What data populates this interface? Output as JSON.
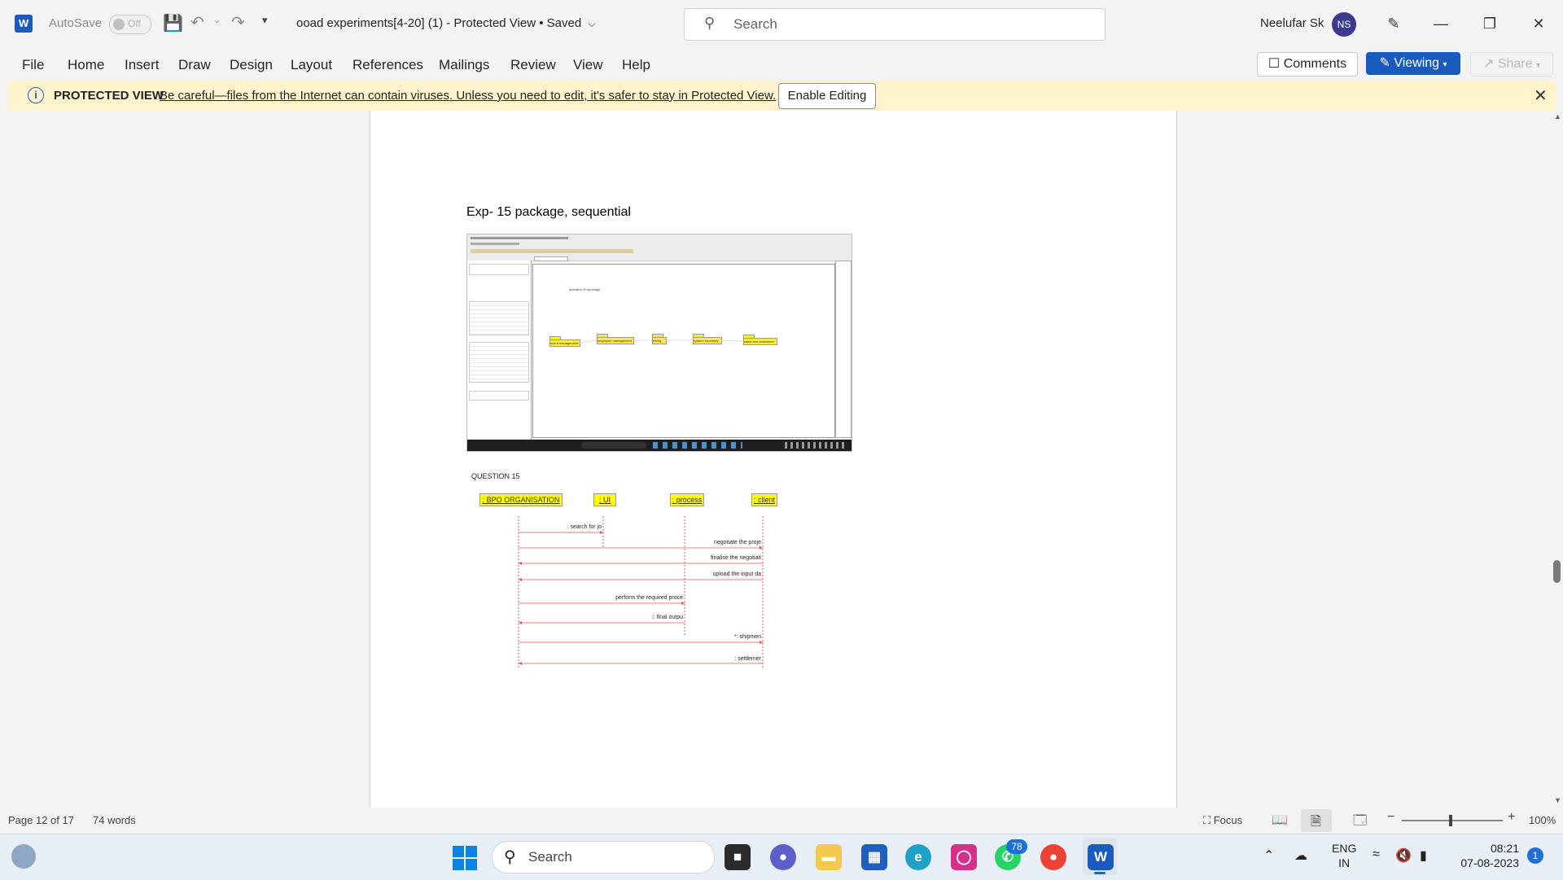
{
  "titlebar": {
    "app_logo": "W",
    "autosave_label": "AutoSave",
    "autosave_state": "Off",
    "doc_title": "ooad experiments[4-20] (1)  -  Protected View • Saved",
    "search_placeholder": "Search",
    "user_name": "Neelufar Sk",
    "user_initials": "NS"
  },
  "ribbon": {
    "tabs": [
      "File",
      "Home",
      "Insert",
      "Draw",
      "Design",
      "Layout",
      "References",
      "Mailings",
      "Review",
      "View",
      "Help"
    ],
    "comments_label": "Comments",
    "viewing_label": "Viewing",
    "share_label": "Share"
  },
  "protected_view": {
    "label": "PROTECTED VIEW",
    "message": "Be careful—files from the Internet can contain viruses. Unless you need to edit, it's safer to stay in Protected View.",
    "enable_button": "Enable Editing"
  },
  "document": {
    "heading": "Exp- 15 package, sequential",
    "embedded_screenshot": {
      "caption_text": "operation Proprietage",
      "packages": [
        "event management",
        "employee management",
        "billing",
        "system boundary",
        "sales and customers"
      ]
    },
    "question_label": "QUESTION 15",
    "sequence_diagram": {
      "lifelines": [
        ": BPO ORGANISATION",
        ": UI",
        ": process",
        ": client"
      ],
      "messages": [
        ": search for jo",
        "negotiate the proje",
        "finalise the negotiati",
        "upload the input da",
        "perform the required proce",
        ":: final outpu",
        "*: shipmen",
        ": settlemer"
      ]
    }
  },
  "statusbar": {
    "page": "Page 12 of 17",
    "words": "74 words",
    "focus": "Focus",
    "zoom": "100%"
  },
  "taskbar": {
    "search_placeholder": "Search",
    "whatsapp_badge": "78",
    "lang_line1": "ENG",
    "lang_line2": "IN",
    "time": "08:21",
    "date": "07-08-2023",
    "notification_count": "1"
  }
}
